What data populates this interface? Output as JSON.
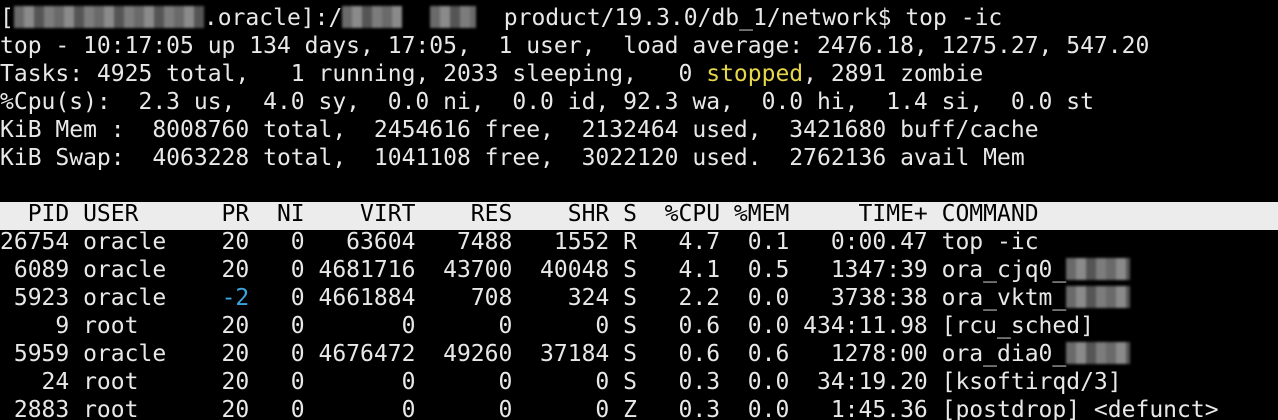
{
  "terminal": {
    "prompt": {
      "prefix": "[",
      "host_part": ".oracle]:/",
      "path_mid": "product/19.3.0/db_1/network$ ",
      "command": "top -ic"
    },
    "summary": {
      "uptime_line": "top - 10:17:05 up 134 days, 17:05,  1 user,  load average: 2476.18, 1275.27, 547.20",
      "tasks_prefix": "Tasks: 4925 total,   1 running, 2033 sleeping,   0 ",
      "tasks_stopped": "stopped",
      "tasks_suffix": ", 2891 zombie",
      "cpu_line": "%Cpu(s):  2.3 us,  4.0 sy,  0.0 ni,  0.0 id, 92.3 wa,  0.0 hi,  1.4 si,  0.0 st",
      "mem_line": "KiB Mem :  8008760 total,  2454616 free,  2132464 used,  3421680 buff/cache",
      "swap_line": "KiB Swap:  4063228 total,  1041108 free,  3022120 used.  2762136 avail Mem"
    },
    "header": "  PID USER      PR  NI    VIRT    RES    SHR S  %CPU %MEM     TIME+ COMMAND",
    "rows": [
      {
        "pre": "26754 oracle    20   0   63604   7488   1552 R   4.7  0.1   0:00.47 top -ic"
      },
      {
        "pre": " 6089 oracle    20   0 4681716  43700  40048 S   4.1  0.5   1347:39 ora_cjq0_"
      },
      {
        "pre_a": " 5923 oracle    ",
        "pr": "-2",
        "pre_b": "   0 4661884    708    324 S   2.2  0.0   3738:38 ora_vktm_"
      },
      {
        "pre": "    9 root      20   0       0      0      0 S   0.6  0.0 434:11.98 [rcu_sched]"
      },
      {
        "pre": " 5959 oracle    20   0 4676472  49260  37184 S   0.6  0.6   1278:00 ora_dia0_"
      },
      {
        "pre": "   24 root      20   0       0      0      0 S   0.3  0.0  34:19.20 [ksoftirqd/3]"
      },
      {
        "pre": " 2883 root      20   0       0      0      0 Z   0.3  0.0   1:45.36 [postdrop] <defunct>"
      }
    ]
  }
}
